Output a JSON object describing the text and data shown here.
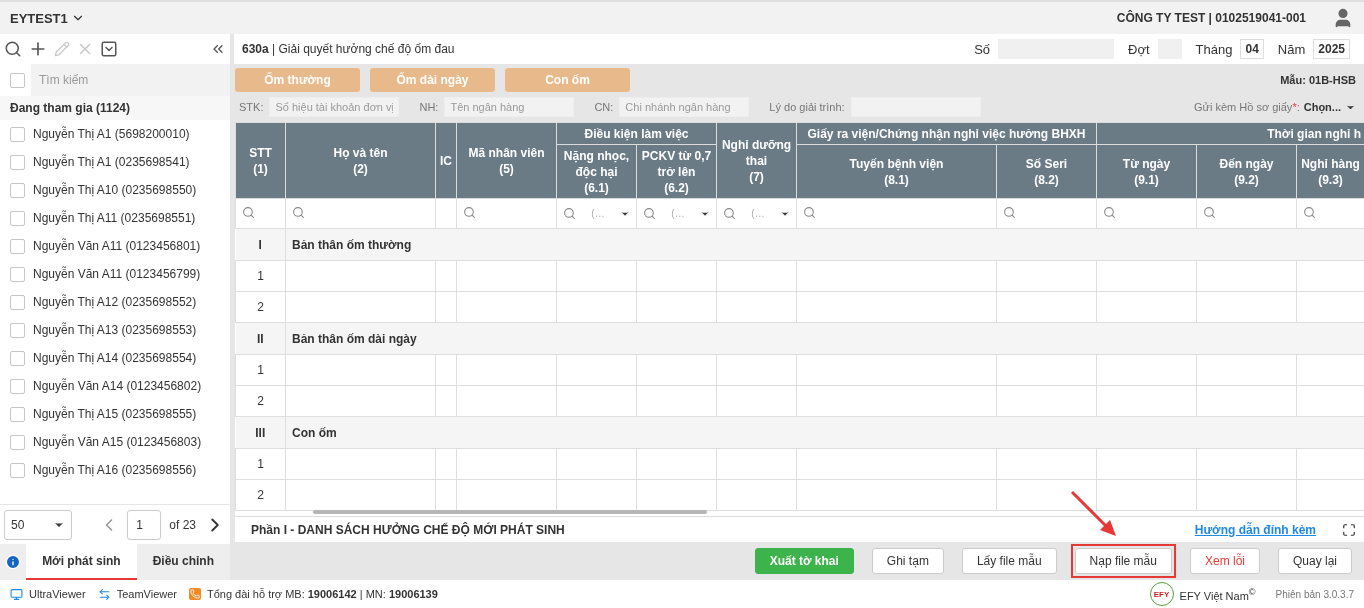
{
  "top_bar": {
    "workspace": "EYTEST1",
    "company": "CÔNG TY TEST | 0102519041-001"
  },
  "sidebar": {
    "toolbar": [
      {
        "kind": "search",
        "disabled": false
      },
      {
        "kind": "add",
        "disabled": false
      },
      {
        "kind": "edit",
        "disabled": true
      },
      {
        "kind": "delete",
        "disabled": true
      },
      {
        "kind": "dropdown",
        "disabled": false
      }
    ],
    "search": {
      "placeholder": "Tìm kiếm",
      "checked": false
    },
    "group": "Đang tham gia (1124)",
    "employees": [
      {
        "name": "Nguyễn Thị A1 (5698200010)",
        "checked": false
      },
      {
        "name": "Nguyễn Thị A1 (0235698541)",
        "checked": false
      },
      {
        "name": "Nguyễn Thị A10 (0235698550)",
        "checked": false
      },
      {
        "name": "Nguyễn Thị A11 (0235698551)",
        "checked": false
      },
      {
        "name": "Nguyễn Văn A11 (0123456801)",
        "checked": false
      },
      {
        "name": "Nguyễn Văn A11 (0123456799)",
        "checked": false
      },
      {
        "name": "Nguyễn Thị A12 (0235698552)",
        "checked": false
      },
      {
        "name": "Nguyễn Thị A13 (0235698553)",
        "checked": false
      },
      {
        "name": "Nguyễn Thị A14 (0235698554)",
        "checked": false
      },
      {
        "name": "Nguyễn Văn A14 (0123456802)",
        "checked": false
      },
      {
        "name": "Nguyễn Thị A15 (0235698555)",
        "checked": false
      },
      {
        "name": "Nguyễn Văn A15 (0123456803)",
        "checked": false
      },
      {
        "name": "Nguyễn Thị A16 (0235698556)",
        "checked": false
      }
    ],
    "pager": {
      "page_size": "50",
      "page": "1",
      "total": "of 23"
    },
    "tabs": [
      {
        "label": "Mới phát sinh",
        "selected": true
      },
      {
        "label": "Điều chỉnh",
        "selected": false
      }
    ]
  },
  "form": {
    "title": "**630a** | Giải quyết hưởng chế độ ốm đau",
    "fields": [
      {
        "label": "Số",
        "kind": "wide"
      },
      {
        "label": "Đợt",
        "kind": "narrow"
      },
      {
        "label": "Tháng",
        "value": "04",
        "kind": "value"
      },
      {
        "label": "Năm",
        "value": "2025",
        "kind": "value"
      }
    ],
    "categories": [
      "Ốm thường",
      "Ốm dài ngày",
      "Con ốm"
    ],
    "template": "Mẫu: 01B-HSB",
    "bank_fields": [
      {
        "label": "STK:",
        "placeholder": "Số hiệu tài khoản đơn vị"
      },
      {
        "label": "NH:",
        "placeholder": "Tên ngân hàng"
      },
      {
        "label": "CN:",
        "placeholder": "Chi nhánh ngân hàng"
      },
      {
        "label": "Lý do giải trình:"
      }
    ],
    "attach": {
      "label": "Gửi kèm Hồ sơ giấy",
      "required_mark": "*",
      "separator": ":",
      "value": "Chọn..."
    }
  },
  "table": {
    "columns": [
      {
        "label": "STT",
        "number": "(1)",
        "filter": {
          "kind": "search"
        }
      },
      {
        "label": "Họ và tên",
        "number": "(2)",
        "filter": {
          "kind": "search"
        }
      },
      {
        "label": "IC"
      },
      {
        "label": "Mã nhân viên",
        "number": "(5)",
        "filter": {
          "kind": "search"
        }
      },
      {
        "label": "Điều kiện làm việc",
        "children": [
          {
            "label": "Nặng nhọc, độc hại",
            "number": "(6.1)",
            "filter": {
              "kind": "dropdown",
              "placeholder": "(…"
            }
          },
          {
            "label": "PCKV từ 0,7 trở lên",
            "number": "(6.2)",
            "filter": {
              "kind": "dropdown",
              "placeholder": "(…"
            }
          }
        ]
      },
      {
        "label": "Nghỉ dưỡng thai",
        "number": "(7)",
        "filter": {
          "kind": "dropdown",
          "placeholder": "(…"
        }
      },
      {
        "label": "Giấy ra viện/Chứng nhận nghỉ việc hưởng BHXH",
        "children": [
          {
            "label": "Tuyến bệnh viện",
            "number": "(8.1)",
            "filter": {
              "kind": "search"
            }
          },
          {
            "label": "Số Seri",
            "number": "(8.2)",
            "filter": {
              "kind": "search"
            }
          }
        ]
      },
      {
        "label": "Thời gian nghỉ h",
        "children": [
          {
            "label": "Từ ngày",
            "number": "(9.1)",
            "filter": {
              "kind": "search"
            }
          },
          {
            "label": "Đến ngày",
            "number": "(9.2)",
            "filter": {
              "kind": "search"
            }
          },
          {
            "label": "Nghỉ hàng",
            "number": "(9.3)",
            "filter": {
              "kind": "search"
            }
          }
        ]
      }
    ],
    "sections": [
      {
        "index": "I",
        "title": "Bản thân ốm thường",
        "rows": [
          "1",
          "2"
        ]
      },
      {
        "index": "II",
        "title": "Bản thân ốm dài ngày",
        "rows": [
          "1",
          "2"
        ]
      },
      {
        "index": "III",
        "title": "Con ốm",
        "rows": [
          "1",
          "2"
        ]
      }
    ]
  },
  "part": {
    "title": "Phần I - DANH SÁCH HƯỞNG CHẾ ĐỘ MỚI PHÁT SINH",
    "link": "Hướng dẫn đính kèm"
  },
  "actions": [
    {
      "label": "Xuất tờ khai",
      "kind": "primary",
      "highlighted": false
    },
    {
      "label": "Ghi tạm",
      "kind": "default",
      "highlighted": false
    },
    {
      "label": "Lấy file mẫu",
      "kind": "default",
      "highlighted": false
    },
    {
      "label": "Nạp file mẫu",
      "kind": "default",
      "highlighted": true
    },
    {
      "label": "Xem lỗi",
      "kind": "danger",
      "highlighted": false
    },
    {
      "label": "Quay lại",
      "kind": "default",
      "highlighted": false
    }
  ],
  "status_bar": {
    "apps": [
      {
        "label": "UltraViewer",
        "kind": "monitor"
      },
      {
        "label": "TeamViewer",
        "kind": "arrows"
      }
    ],
    "hotline": "Tổng đài hỗ trợ MB: **19006142** | MN: **19006139**",
    "brand_logo": "EFY",
    "brand": "EFY Việt Nam$^{©}$",
    "version": "Phiên bản 3.0.3.7"
  }
}
